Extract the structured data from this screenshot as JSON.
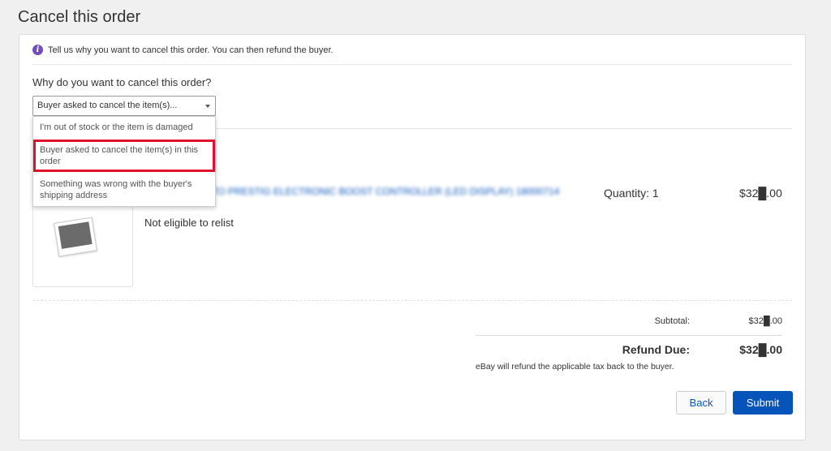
{
  "page": {
    "title": "Cancel this order"
  },
  "info": {
    "text": "Tell us why you want to cancel this order. You can then refund the buyer."
  },
  "form": {
    "question": "Why do you want to cancel this order?",
    "selected": "Buyer asked to cancel the item(s)...",
    "options": [
      "I'm out of stock or the item is damaged",
      "Buyer asked to cancel the item(s) in this order",
      "Something was wrong with the buyer's shipping address"
    ]
  },
  "item": {
    "title": "ATO PRESTIG ELECTRONIC BOOST CONTROLLER (LED DISPLAY) 18000714",
    "quantity": "Quantity: 1",
    "price": "$32█.00",
    "relist": "Not eligible to relist"
  },
  "totals": {
    "subtotal_label": "Subtotal:",
    "subtotal_value": "$32█.00",
    "refund_label": "Refund Due:",
    "refund_value": "$32█.00",
    "tax_note": "eBay will refund the applicable tax back to the buyer."
  },
  "buttons": {
    "back": "Back",
    "submit": "Submit"
  },
  "colors": {
    "accent": "#0654ba",
    "highlight": "#e0122d",
    "info_icon": "#6f4eb8"
  },
  "icons": {
    "info": "info-icon",
    "caret": "chevron-down-icon",
    "thumbnail": "image-placeholder-icon"
  }
}
